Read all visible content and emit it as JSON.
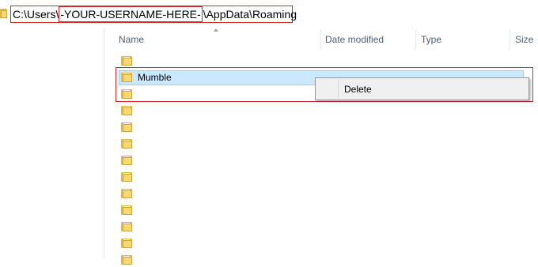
{
  "address_bar": {
    "prefix": "C:\\Users\\",
    "username": "-YOUR-USERNAME-HERE-",
    "suffix": "\\AppData\\Roaming"
  },
  "columns": [
    "Name",
    "Date modified",
    "Type",
    "Size"
  ],
  "files": {
    "selected_name": "Mumble",
    "folder_count": 13
  },
  "context_menu": {
    "items": [
      "Delete"
    ]
  },
  "colors": {
    "highlight": "#d9262d",
    "selection": "#cce8ff",
    "header_text": "#4c607a"
  },
  "icons": {
    "folder": "folder-icon"
  }
}
